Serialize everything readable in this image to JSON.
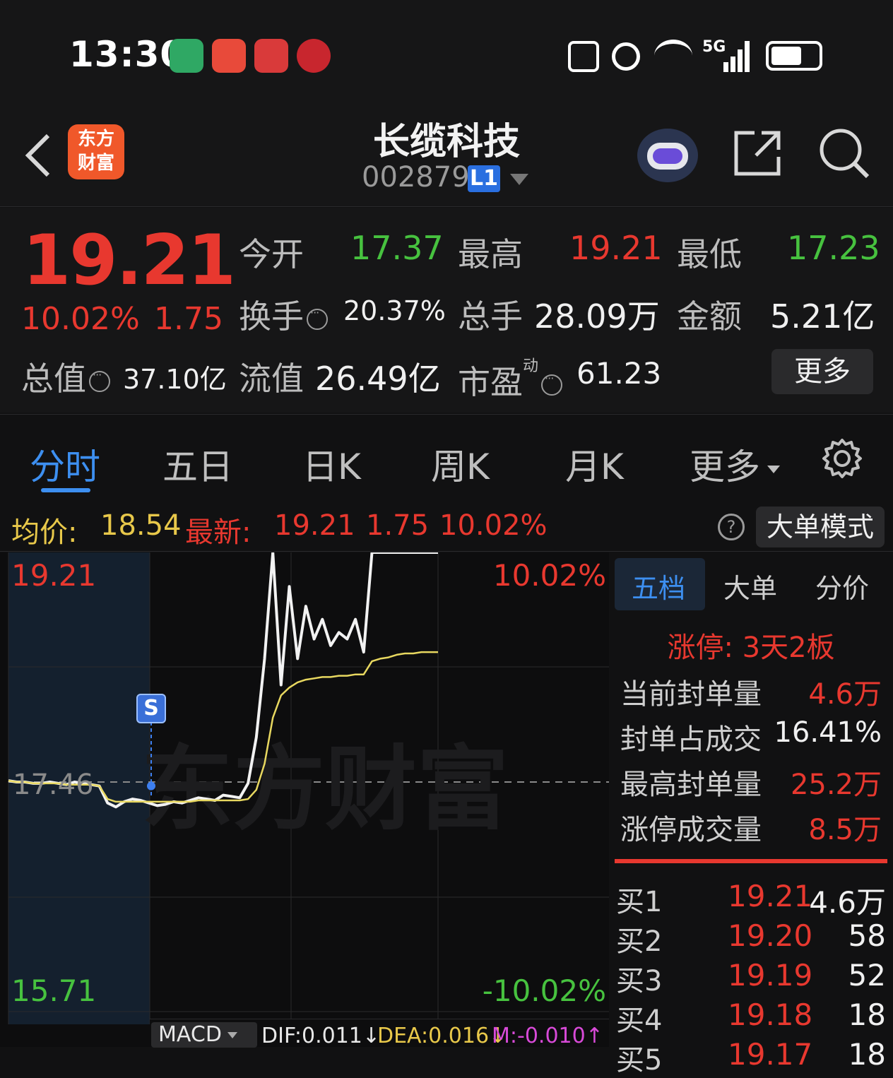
{
  "status_bar": {
    "time": "13:30",
    "signal_label": "5G"
  },
  "header": {
    "app_name": "东方\n财富",
    "stock_name": "长缆科技",
    "stock_code": "002879",
    "level_badge": "L1"
  },
  "quote": {
    "price": "19.21",
    "change_pct": "10.02%",
    "change_amt": "1.75",
    "open_label": "今开",
    "open_value": "17.37",
    "high_label": "最高",
    "high_value": "19.21",
    "low_label": "最低",
    "low_value": "17.23",
    "turnover_label": "换手",
    "turnover_value": "20.37%",
    "volume_label": "总手",
    "volume_value": "28.09万",
    "amount_label": "金额",
    "amount_value": "5.21亿",
    "mktcap_label": "总值",
    "mktcap_value": "37.10亿",
    "float_label": "流值",
    "float_value": "26.49亿",
    "pe_label": "市盈",
    "pe_sup": "动",
    "pe_value": "61.23",
    "more_button": "更多"
  },
  "tabs": [
    "分时",
    "五日",
    "日K",
    "周K",
    "月K",
    "更多"
  ],
  "info_bar": {
    "avg_label": "均价:",
    "avg_value": "18.54",
    "latest_label": "最新:",
    "latest_value": "19.21",
    "latest_change": "1.75",
    "latest_pct": "10.02%",
    "mode_button": "大单模式"
  },
  "chart_labels": {
    "top_price": "19.21",
    "top_pct": "10.02%",
    "mid_price": "17.46",
    "bottom_price": "15.71",
    "bottom_pct": "-10.02%",
    "s_marker": "S",
    "watermark": "东方财富",
    "indicator": "MACD",
    "dif": "DIF:0.011↓",
    "dea": "DEA:0.016↓",
    "m": "M:-0.010↑"
  },
  "chart_data": {
    "type": "line",
    "ylim": [
      15.71,
      19.21
    ],
    "series": [
      {
        "values": [
          17.47,
          17.46,
          17.46,
          17.45,
          17.45,
          17.46,
          17.45,
          17.44,
          17.46,
          17.45,
          17.44,
          17.43,
          17.3,
          17.27,
          17.31,
          17.33,
          17.32,
          17.3,
          17.28,
          17.29,
          17.31,
          17.3,
          17.32,
          17.34,
          17.33,
          17.32,
          17.36,
          17.35,
          17.34,
          17.45,
          17.8,
          18.4,
          19.21,
          18.2,
          18.95,
          18.4,
          18.8,
          18.55,
          18.7,
          18.5,
          18.6,
          18.55,
          18.7,
          18.45,
          19.21,
          19.21,
          19.21,
          19.21,
          19.21,
          19.21,
          19.21,
          19.21,
          19.21
        ]
      },
      {
        "values": [
          17.47,
          17.46,
          17.46,
          17.45,
          17.45,
          17.45,
          17.45,
          17.44,
          17.44,
          17.44,
          17.44,
          17.43,
          17.33,
          17.31,
          17.31,
          17.31,
          17.31,
          17.31,
          17.31,
          17.31,
          17.31,
          17.31,
          17.31,
          17.32,
          17.32,
          17.32,
          17.32,
          17.32,
          17.32,
          17.33,
          17.4,
          17.6,
          17.95,
          18.12,
          18.18,
          18.22,
          18.24,
          18.25,
          18.26,
          18.26,
          18.27,
          18.27,
          18.28,
          18.28,
          18.38,
          18.4,
          18.41,
          18.43,
          18.44,
          18.44,
          18.45,
          18.45,
          18.45
        ]
      }
    ]
  },
  "side_panel": {
    "tabs": [
      "五档",
      "大单",
      "分价"
    ],
    "limit_up": "涨停: 3天2板",
    "stats": [
      {
        "label": "当前封单量",
        "value": "4.6万"
      },
      {
        "label": "封单占成交",
        "value": "16.41%"
      },
      {
        "label": "最高封单量",
        "value": "25.2万"
      },
      {
        "label": "涨停成交量",
        "value": "8.5万"
      }
    ],
    "book": [
      {
        "label": "买1",
        "price": "19.21",
        "vol": "4.6万"
      },
      {
        "label": "买2",
        "price": "19.20",
        "vol": "58"
      },
      {
        "label": "买3",
        "price": "19.19",
        "vol": "52"
      },
      {
        "label": "买4",
        "price": "19.18",
        "vol": "18"
      },
      {
        "label": "买5",
        "price": "19.17",
        "vol": "18"
      }
    ]
  },
  "colors": {
    "up": "#e8382f",
    "down": "#47c23f",
    "accent": "#2a6fe0",
    "avg_line": "#e8d860"
  }
}
